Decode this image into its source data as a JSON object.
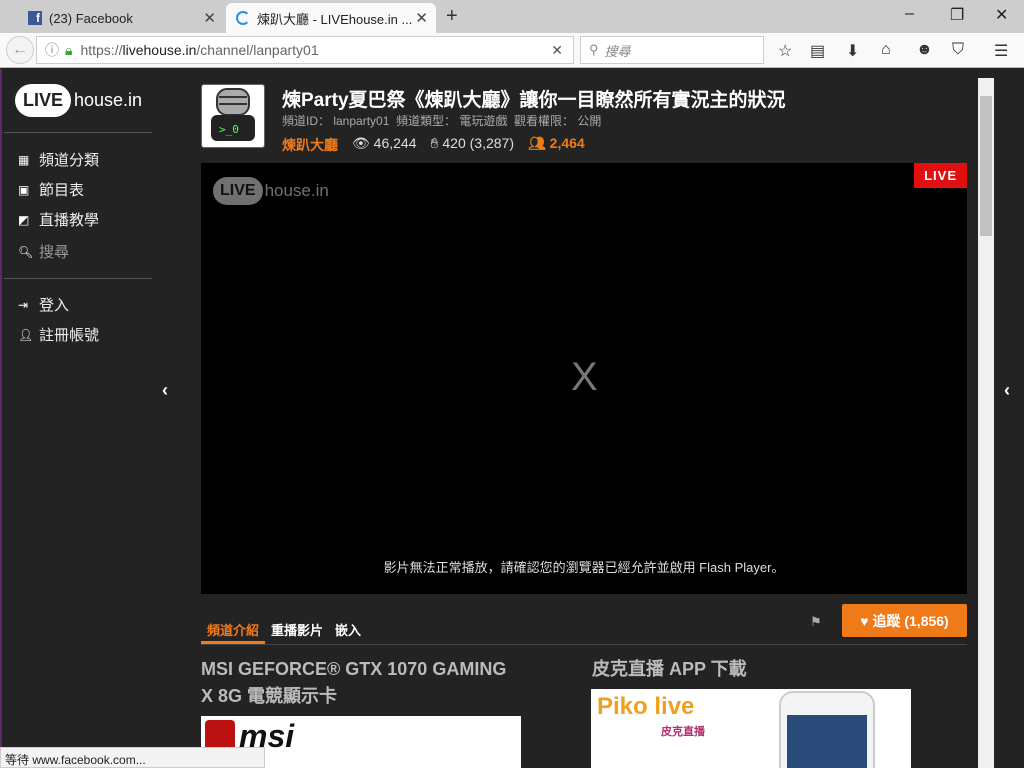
{
  "browser": {
    "tabs": [
      {
        "label": "(23) Facebook",
        "icon": "facebook-icon"
      },
      {
        "label": "煉趴大廳 - LIVEhouse.in ...",
        "icon": "loading-spinner-icon"
      }
    ],
    "url_prefix": "https://",
    "url_host": "livehouse.in",
    "url_path": "/channel/lanparty01",
    "search_placeholder": "搜尋",
    "status": "等待 www.facebook.com..."
  },
  "sidebar": {
    "logo_live": "LIVE",
    "logo_house": "house.in",
    "items": [
      {
        "label": "頻道分類"
      },
      {
        "label": "節目表"
      },
      {
        "label": "直播教學"
      },
      {
        "label": "搜尋"
      },
      {
        "label": "登入"
      },
      {
        "label": "註冊帳號"
      }
    ]
  },
  "channel": {
    "title": "煉Party夏巴祭《煉趴大廳》讓你一目瞭然所有實況主的狀況",
    "meta": "頻道ID： lanparty01  頻道類型： 電玩遊戲  觀看權限： 公開",
    "owner": "煉趴大廳",
    "views": "46,244",
    "likes": "420 (3,287)",
    "followers": "2,464"
  },
  "player": {
    "live_badge": "LIVE",
    "logo_live": "LIVE",
    "logo_house": "house.in",
    "x": "X",
    "message": "影片無法正常播放，請確認您的瀏覽器已經允許並啟用 Flash Player。"
  },
  "tabs": [
    {
      "label": "頻道介紹"
    },
    {
      "label": "重播影片"
    },
    {
      "label": "嵌入"
    }
  ],
  "follow_label": "追蹤 (1,856)",
  "sections": {
    "left_title_1": "MSI GEFORCE® GTX 1070 GAMING",
    "left_title_2": "X 8G 電競顯示卡",
    "left_img_text": "msi",
    "right_title": "皮克直播 APP 下載",
    "right_img_text": "Piko live",
    "right_img_sub": "皮克直播"
  },
  "colors": {
    "accent": "#ef7a1a",
    "live": "#e01010"
  }
}
